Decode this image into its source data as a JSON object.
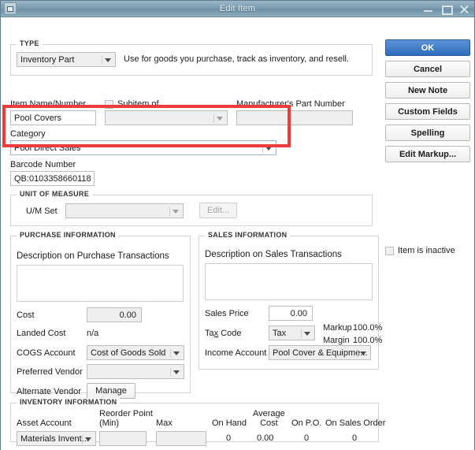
{
  "window": {
    "title": "Edit Item",
    "system_icon": "window-menu-icon",
    "controls": {
      "minimize": "minimize-icon",
      "maximize": "maximize-icon",
      "close": "close-icon"
    }
  },
  "type_section": {
    "group_label": "TYPE",
    "value": "Inventory Part",
    "description": "Use for goods you purchase, track as inventory, and resell."
  },
  "identity": {
    "item_name_label": "Item Name/Number",
    "item_name_value": "Pool Covers",
    "subitem_label": "Subitem of",
    "subitem_checked": false,
    "subitem_value": "",
    "manufacturer_label": "Manufacturer's Part Number",
    "manufacturer_value": "",
    "category_label": "Category",
    "category_value": "Pool Direct Sales",
    "barcode_label": "Barcode Number",
    "barcode_value": "QB:0103358660118"
  },
  "unit_of_measure": {
    "group_label": "UNIT OF MEASURE",
    "um_set_label": "U/M Set",
    "um_set_value": "",
    "edit_button": "Edit..."
  },
  "purchase_information": {
    "group_label": "PURCHASE INFORMATION",
    "description_label": "Description on Purchase Transactions",
    "description_value": "",
    "cost_label": "Cost",
    "cost_value": "0.00",
    "landed_cost_label": "Landed Cost",
    "landed_cost_value": "n/a",
    "cogs_label": "COGS Account",
    "cogs_value": "Cost of Goods Sold",
    "preferred_vendor_label": "Preferred Vendor",
    "preferred_vendor_value": "",
    "alternate_vendor_label": "Alternate Vendor",
    "manage_button": "Manage"
  },
  "sales_information": {
    "group_label": "SALES INFORMATION",
    "description_label": "Description on Sales Transactions",
    "description_value": "",
    "sales_price_label": "Sales Price",
    "sales_price_value": "0.00",
    "tax_code_label": "Tax Code",
    "tax_code_value": "Tax",
    "markup_label": "Markup",
    "markup_value": "100.0%",
    "margin_label": "Margin",
    "margin_value": "100.0%",
    "income_account_label": "Income Account",
    "income_account_value": "Pool Cover & Equipme..."
  },
  "inventory_information": {
    "group_label": "INVENTORY INFORMATION",
    "asset_account_label": "Asset Account",
    "asset_account_value": "Materials Invent...",
    "reorder_point_label_line1": "Reorder Point",
    "reorder_point_label_line2": "(Min)",
    "reorder_point_value": "",
    "max_label": "Max",
    "max_value": "",
    "on_hand_label": "On Hand",
    "on_hand_value": "0",
    "average_cost_label_line1": "Average",
    "average_cost_label_line2": "Cost",
    "average_cost_value": "0.00",
    "on_po_label": "On P.O.",
    "on_po_value": "0",
    "on_sales_order_label": "On Sales Order",
    "on_sales_order_value": "0"
  },
  "side_buttons": {
    "ok": "OK",
    "cancel": "Cancel",
    "new_note": "New Note",
    "custom_fields": "Custom Fields",
    "spelling": "Spelling",
    "edit_markup": "Edit Markup..."
  },
  "inactive": {
    "label": "Item is inactive",
    "checked": false
  },
  "annotation": {
    "highlight_color": "#ee3b3b",
    "target": "category-field"
  }
}
